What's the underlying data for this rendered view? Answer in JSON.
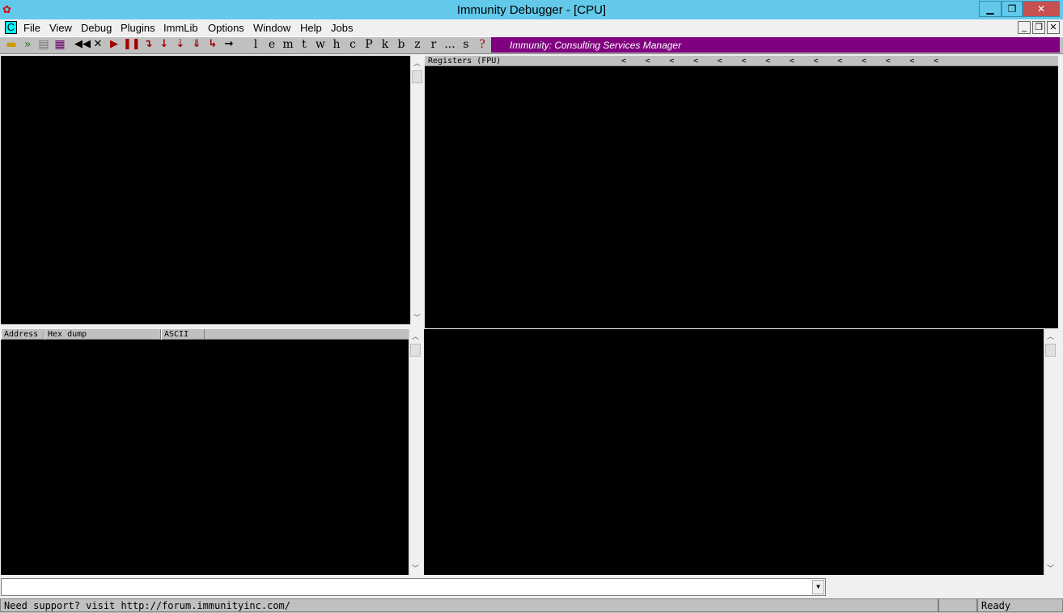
{
  "window": {
    "title": "Immunity Debugger - [CPU]",
    "minimize": "▁",
    "restore": "❐",
    "close": "✕"
  },
  "menu": {
    "mdi_icon": "C",
    "items": [
      "File",
      "View",
      "Debug",
      "Plugins",
      "ImmLib",
      "Options",
      "Window",
      "Help",
      "Jobs"
    ],
    "mdi_min": "_",
    "mdi_restore": "❐",
    "mdi_close": "✕"
  },
  "toolbar": {
    "letters": [
      "l",
      "e",
      "m",
      "t",
      "w",
      "h",
      "c",
      "P",
      "k",
      "b",
      "z",
      "r",
      "...",
      "s",
      "?"
    ],
    "banner": "Immunity: Consulting Services Manager"
  },
  "panes": {
    "registers_header": "Registers (FPU)",
    "register_markers": [
      "<",
      "<",
      "<",
      "<",
      "<",
      "<",
      "<",
      "<",
      "<",
      "<",
      "<",
      "<",
      "<",
      "<"
    ],
    "dump_columns": [
      "Address",
      "Hex dump",
      "ASCII"
    ]
  },
  "command": {
    "value": ""
  },
  "status": {
    "message": "Need support? visit http://forum.immunityinc.com/",
    "state": "Ready"
  }
}
